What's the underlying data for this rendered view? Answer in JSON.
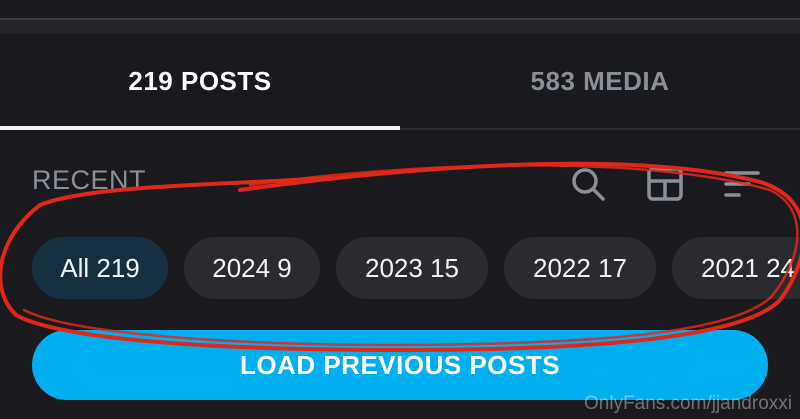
{
  "tabs": [
    {
      "label": "219 POSTS",
      "active": true
    },
    {
      "label": "583 MEDIA",
      "active": false
    }
  ],
  "section": {
    "label": "RECENT"
  },
  "toolbar_icons": [
    "search-icon",
    "grid-icon",
    "sort-icon"
  ],
  "chips": [
    {
      "label": "All 219",
      "active": true
    },
    {
      "label": "2024 9",
      "active": false
    },
    {
      "label": "2023 15",
      "active": false
    },
    {
      "label": "2022 17",
      "active": false
    },
    {
      "label": "2021 24",
      "active": false
    }
  ],
  "load_button": {
    "label": "LOAD PREVIOUS POSTS"
  },
  "watermark": "OnlyFans.com/jjandroxxi",
  "colors": {
    "background": "#1a1a1e",
    "accent": "#00aff0",
    "chip": "#2a2b30",
    "chip_active": "#15303e",
    "annotation": "#e0281a"
  }
}
